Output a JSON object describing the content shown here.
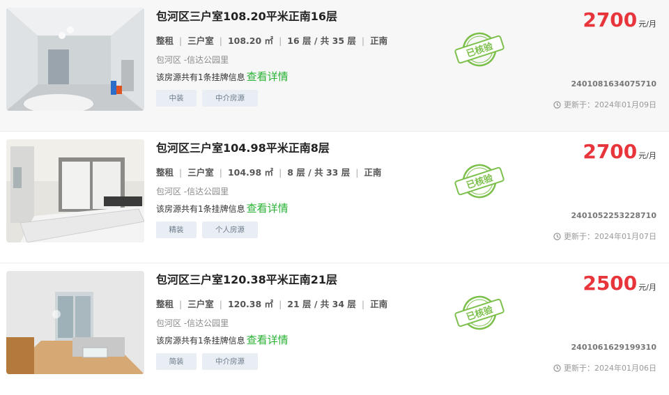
{
  "listings": [
    {
      "title": "包河区三户室108.20平米正南16层",
      "rent_type": "整租",
      "layout": "三户室",
      "area": "108.20 ㎡",
      "floor": "16 层 / 共 35 层",
      "orientation": "正南",
      "community": "包河区 -信达公园里",
      "listing_info": "该房源共有1条挂牌信息",
      "detail_link": "查看详情",
      "tags": [
        "中装",
        "中介房源"
      ],
      "verified_stamp": "已核验",
      "price": "2700",
      "price_unit": "元/月",
      "listing_id": "2401081634075710",
      "updated": "更新于：2024年01月09日"
    },
    {
      "title": "包河区三户室104.98平米正南8层",
      "rent_type": "整租",
      "layout": "三户室",
      "area": "104.98 ㎡",
      "floor": "8 层 / 共 33 层",
      "orientation": "正南",
      "community": "包河区 -信达公园里",
      "listing_info": "该房源共有1条挂牌信息",
      "detail_link": "查看详情",
      "tags": [
        "精装",
        "个人房源"
      ],
      "verified_stamp": "已核验",
      "price": "2700",
      "price_unit": "元/月",
      "listing_id": "2401052253228710",
      "updated": "更新于：2024年01月07日"
    },
    {
      "title": "包河区三户室120.38平米正南21层",
      "rent_type": "整租",
      "layout": "三户室",
      "area": "120.38 ㎡",
      "floor": "21 层 / 共 34 层",
      "orientation": "正南",
      "community": "包河区 -信达公园里",
      "listing_info": "该房源共有1条挂牌信息",
      "detail_link": "查看详情",
      "tags": [
        "简装",
        "中介房源"
      ],
      "verified_stamp": "已核验",
      "price": "2500",
      "price_unit": "元/月",
      "listing_id": "2401061629199310",
      "updated": "更新于：2024年01月06日"
    }
  ],
  "colors": {
    "price": "#e8343b",
    "link": "#27b232",
    "stamp": "#7cc04b",
    "tag_bg": "#e9eef4"
  }
}
